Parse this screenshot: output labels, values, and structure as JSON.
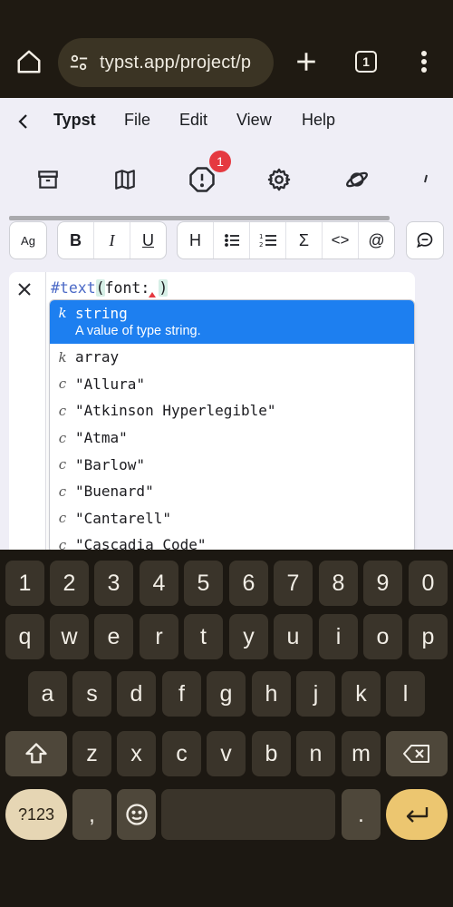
{
  "browser": {
    "url": "typst.app/project/p",
    "tab_count": "1"
  },
  "menu": {
    "brand": "Typst",
    "items": [
      "File",
      "Edit",
      "View",
      "Help"
    ]
  },
  "toolbar": {
    "notification_count": "1",
    "icons": [
      "archive-icon",
      "map-icon",
      "alert-octagon-icon",
      "gear-icon",
      "planet-icon"
    ]
  },
  "format": {
    "ag": "Ag",
    "bold": "B",
    "italic": "I",
    "underline": "U",
    "heading": "H",
    "sigma": "Σ",
    "code": "<>",
    "mention": "@"
  },
  "editor": {
    "code_fn": "#text",
    "code_open": "(",
    "code_arg": "font: ",
    "code_close": ")"
  },
  "completion": {
    "selected": {
      "kind": "k",
      "label": "string",
      "detail": "A value of type string."
    },
    "items": [
      {
        "kind": "k",
        "label": "array"
      },
      {
        "kind": "c",
        "label": "\"Allura\""
      },
      {
        "kind": "c",
        "label": "\"Atkinson Hyperlegible\""
      },
      {
        "kind": "c",
        "label": "\"Atma\""
      },
      {
        "kind": "c",
        "label": "\"Barlow\""
      },
      {
        "kind": "c",
        "label": "\"Buenard\""
      },
      {
        "kind": "c",
        "label": "\"Cantarell\""
      },
      {
        "kind": "c",
        "label": "\"Cascadia Code\""
      }
    ]
  },
  "keyboard": {
    "row1": [
      "1",
      "2",
      "3",
      "4",
      "5",
      "6",
      "7",
      "8",
      "9",
      "0"
    ],
    "row2": [
      "q",
      "w",
      "e",
      "r",
      "t",
      "y",
      "u",
      "i",
      "o",
      "p"
    ],
    "row3": [
      "a",
      "s",
      "d",
      "f",
      "g",
      "h",
      "j",
      "k",
      "l"
    ],
    "row4": [
      "z",
      "x",
      "c",
      "v",
      "b",
      "n",
      "m"
    ],
    "sym_label": "?123",
    "comma": ",",
    "period": "."
  }
}
